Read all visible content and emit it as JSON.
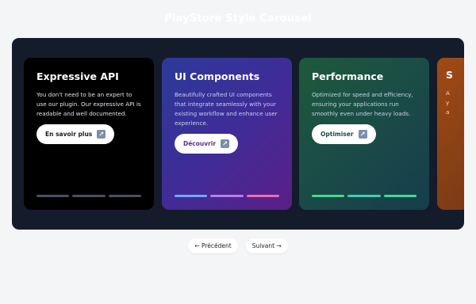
{
  "page": {
    "title": "PlayStore Style Carousel"
  },
  "cards": [
    {
      "title": "Expressive API",
      "text": "You don't need to be an expert to use our plugin. Our expressive API is readable and well documented.",
      "button_label": "En savoir plus",
      "button_icon": "↗",
      "progress_colors": [
        "#4a5160",
        "#4a5160",
        "#4a5160"
      ]
    },
    {
      "title": "UI Components",
      "text": "Beautifully crafted UI components that integrate seamlessly with your existing workflow and enhance user experience.",
      "button_label": "Découvrir",
      "button_icon": "↗",
      "progress_colors": [
        "#6ea8ff",
        "#b57cf0",
        "#f06ab4"
      ]
    },
    {
      "title": "Performance",
      "text": "Optimized for speed and efficiency, ensuring your applications run smoothly even under heavy loads.",
      "button_label": "Optimiser",
      "button_icon": "↗",
      "progress_colors": [
        "#46d98a",
        "#3dcfb0",
        "#3fd99a"
      ]
    },
    {
      "title": "S",
      "text_lines": [
        "A",
        "y",
        "a"
      ]
    }
  ],
  "nav": {
    "prev_label": "← Précédent",
    "next_label": "Suivant →"
  }
}
